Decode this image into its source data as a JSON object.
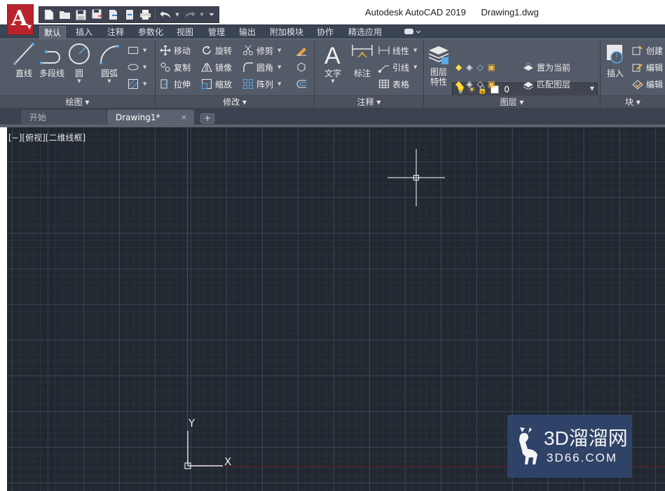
{
  "title_bar": {
    "app_letter": "A",
    "title": "Autodesk AutoCAD 2019      Drawing1.dwg",
    "quick_access": [
      "new-icon",
      "open-icon",
      "save-icon",
      "save-as-icon",
      "export-icon",
      "web-mobile-icon",
      "print-icon",
      "undo-icon",
      "redo-icon",
      "customize-icon"
    ]
  },
  "ribbon": {
    "tabs": [
      "默认",
      "插入",
      "注释",
      "参数化",
      "视图",
      "管理",
      "输出",
      "附加模块",
      "协作",
      "精选应用"
    ],
    "active_tab": "默认",
    "panels": {
      "draw": {
        "title": "绘图 ▾",
        "tools": [
          "直线",
          "多段线",
          "圆",
          "圆弧"
        ]
      },
      "modify": {
        "title": "修改 ▾",
        "tools": [
          "移动",
          "旋转",
          "修剪",
          "复制",
          "镜像",
          "圆角",
          "拉伸",
          "缩放",
          "阵列"
        ]
      },
      "annotation": {
        "title": "注释 ▾",
        "tools": [
          "文字",
          "标注",
          "线性",
          "引线",
          "表格"
        ]
      },
      "layers": {
        "title": "图层 ▾",
        "properties_label": "图层\n特性",
        "current_layer": "0",
        "tools": [
          "置为当前",
          "匹配图层"
        ]
      },
      "block": {
        "title": "块 ▾",
        "tools": [
          "插入",
          "创建",
          "编辑",
          "编辑"
        ]
      }
    }
  },
  "doc_tabs": {
    "start": "开始",
    "drawing": "Drawing1*",
    "close": "×",
    "add": "+"
  },
  "viewport": {
    "label": "[−][俯视][二维线框]",
    "axis_y": "Y",
    "axis_x": "X"
  },
  "watermark": {
    "brand": "3D溜溜网",
    "domain": "3D66.COM"
  },
  "colors": {
    "app_button": "#b8232d",
    "ribbon_bg": "#545b68",
    "canvas_bg": "#212830",
    "y_axis": "#2f6b32",
    "x_axis": "#6a1f24",
    "watermark_bg": "#30446b"
  }
}
